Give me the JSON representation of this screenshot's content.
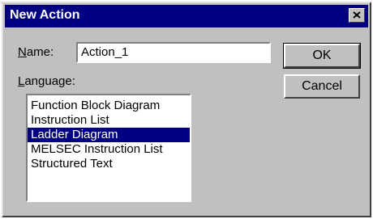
{
  "dialog": {
    "title": "New Action",
    "close_glyph": "×"
  },
  "name_field": {
    "label_accel": "N",
    "label_rest": "ame:",
    "value": "Action_1"
  },
  "language": {
    "label_accel": "L",
    "label_rest": "anguage:",
    "items": [
      "Function Block Diagram",
      "Instruction List",
      "Ladder Diagram",
      "MELSEC Instruction List",
      "Structured Text"
    ],
    "selected_index": 2
  },
  "buttons": {
    "ok": "OK",
    "cancel": "Cancel"
  },
  "colors": {
    "title_bar": "#000080",
    "dialog_face": "#c0c0c0",
    "selection": "#000080"
  }
}
